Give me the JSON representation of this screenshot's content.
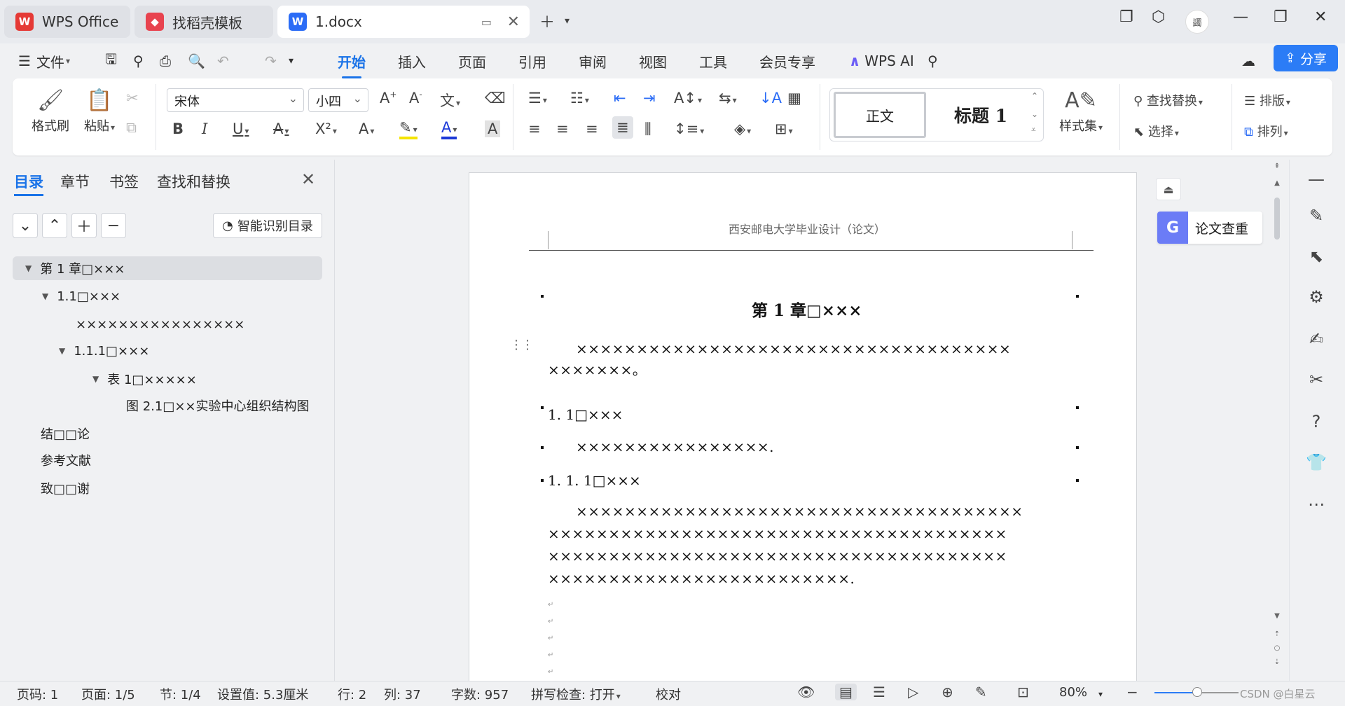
{
  "tabs": [
    {
      "label": "WPS Office",
      "icon": "wps-logo-icon"
    },
    {
      "label": "找稻壳模板",
      "icon": "docer-icon"
    },
    {
      "label": "1.docx",
      "icon": "word-doc-icon"
    }
  ],
  "avatar_text": "蠲",
  "menu": {
    "file_label": "文件",
    "tabs": [
      "开始",
      "插入",
      "页面",
      "引用",
      "审阅",
      "视图",
      "工具",
      "会员专享"
    ],
    "active_tab": "开始",
    "wps_ai_label": "WPS AI",
    "share_label": "分享"
  },
  "ribbon": {
    "format_painter": "格式刷",
    "paste": "粘贴",
    "font_name": "宋体",
    "font_size": "小四",
    "style_normal": "正文",
    "style_heading1": "标题 1",
    "style_set": "样式集",
    "find_replace": "查找替换",
    "select": "选择",
    "layout": "排版",
    "arrange": "排列"
  },
  "nav": {
    "tabs": [
      "目录",
      "章节",
      "书签",
      "查找和替换"
    ],
    "active_tab": "目录",
    "smart_toc_label": "智能识别目录",
    "toc": [
      {
        "text": "第 1 章□×××",
        "level": 1,
        "arrow": true,
        "selected": true
      },
      {
        "text": "1.1□×××",
        "level": 2,
        "arrow": true
      },
      {
        "text": "××××××××××××××××",
        "level": 3,
        "arrow": false
      },
      {
        "text": "1.1.1□×××",
        "level": 3,
        "arrow": true
      },
      {
        "text": "表 1□×××××",
        "level": 4,
        "arrow": true
      },
      {
        "text": "图 2.1□××实验中心组织结构图",
        "level": 5,
        "arrow": false
      },
      {
        "text": "结□□论",
        "level": 1,
        "arrow": false
      },
      {
        "text": "参考文献",
        "level": 1,
        "arrow": false
      },
      {
        "text": "致□□谢",
        "level": 1,
        "arrow": false
      }
    ]
  },
  "document": {
    "header": "西安邮电大学毕业设计（论文）",
    "chapter_title": "第 1 章□×××",
    "para1_line1": "××××××××××××××××××××××××××××××××××××",
    "para1_line2": "×××××××。",
    "sec_1_1": "1. 1□×××",
    "para2": "××××××××××××××××.",
    "sec_1_1_1": "1. 1. 1□×××",
    "para3_line1": "×××××××××××××××××××××××××××××××××××××",
    "para3_line2": "××××××××××××××××××××××××××××××××××××××",
    "para3_line3": "××××××××××××××××××××××××××××××××××××××",
    "para3_line4": "×××××××××××××××××××××××××.",
    "paper_check_label": "论文查重"
  },
  "status": {
    "page_code": "页码: 1",
    "page": "页面: 1/5",
    "section": "节: 1/4",
    "setting": "设置值: 5.3厘米",
    "row": "行: 2",
    "col": "列: 37",
    "word_count": "字数: 957",
    "spell_check": "拼写检查: 打开",
    "proofread": "校对",
    "zoom": "80%",
    "zoom_level": 0.5,
    "watermark": "CSDN @白星云"
  },
  "colors": {
    "accent": "#1a73e8",
    "share_bg": "#2b7cf6",
    "paper_check_icon": "#6b7cf6",
    "wps_red": "#e53935"
  }
}
